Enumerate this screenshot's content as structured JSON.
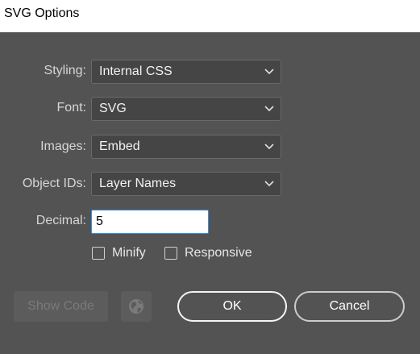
{
  "window": {
    "title": "SVG Options"
  },
  "form": {
    "styling": {
      "label": "Styling:",
      "value": "Internal CSS",
      "icon": "chevron-down-icon"
    },
    "font": {
      "label": "Font:",
      "value": "SVG",
      "icon": "chevron-down-icon"
    },
    "images": {
      "label": "Images:",
      "value": "Embed",
      "icon": "chevron-down-icon"
    },
    "object_ids": {
      "label": "Object IDs:",
      "value": "Layer Names",
      "icon": "chevron-down-icon"
    },
    "decimal": {
      "label": "Decimal:",
      "value": "5"
    },
    "minify": {
      "label": "Minify",
      "checked": false
    },
    "responsive": {
      "label": "Responsive",
      "checked": false
    }
  },
  "buttons": {
    "show_code": "Show Code",
    "globe_icon": "globe-icon",
    "ok": "OK",
    "cancel": "Cancel"
  },
  "colors": {
    "dialog_bg": "#535353",
    "field_bg": "#454545",
    "label_text": "#d6d6d6",
    "focus_border": "#3a8ee0"
  }
}
